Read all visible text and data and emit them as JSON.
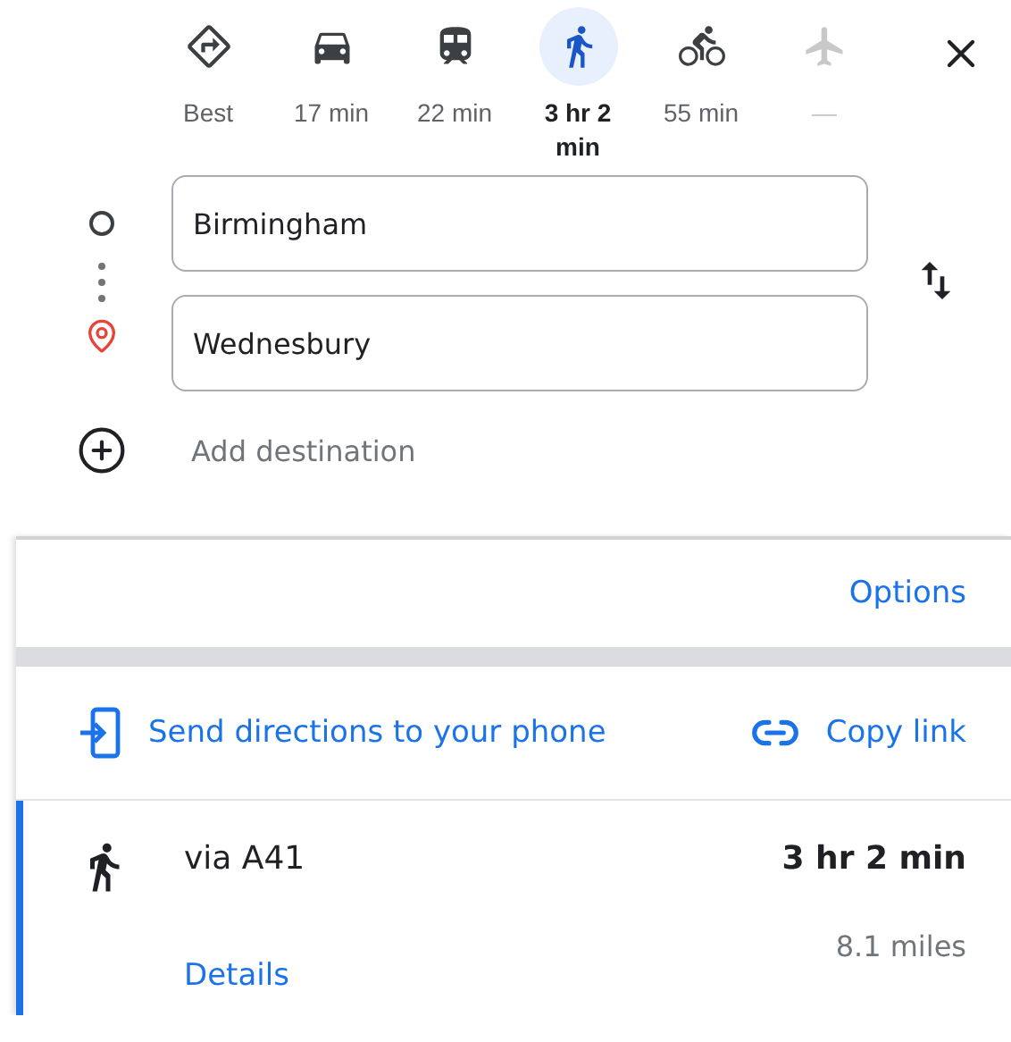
{
  "modes": [
    {
      "kind": "best",
      "label": "Best",
      "selected": false,
      "disabled": false
    },
    {
      "kind": "car",
      "label": "17 min",
      "selected": false,
      "disabled": false
    },
    {
      "kind": "train",
      "label": "22 min",
      "selected": false,
      "disabled": false
    },
    {
      "kind": "walk",
      "label": "3 hr 2 min",
      "selected": true,
      "disabled": false
    },
    {
      "kind": "bike",
      "label": "55 min",
      "selected": false,
      "disabled": false
    },
    {
      "kind": "flight",
      "label": "—",
      "selected": false,
      "disabled": true
    }
  ],
  "origin": {
    "value": "Birmingham"
  },
  "destination": {
    "value": "Wednesbury"
  },
  "add_destination": "Add destination",
  "options": "Options",
  "share": {
    "send": "Send directions to your phone",
    "copy": "Copy link"
  },
  "route": {
    "via": "via A41",
    "duration": "3 hr 2 min",
    "distance": "8.1 miles",
    "details": "Details",
    "selected": true
  }
}
